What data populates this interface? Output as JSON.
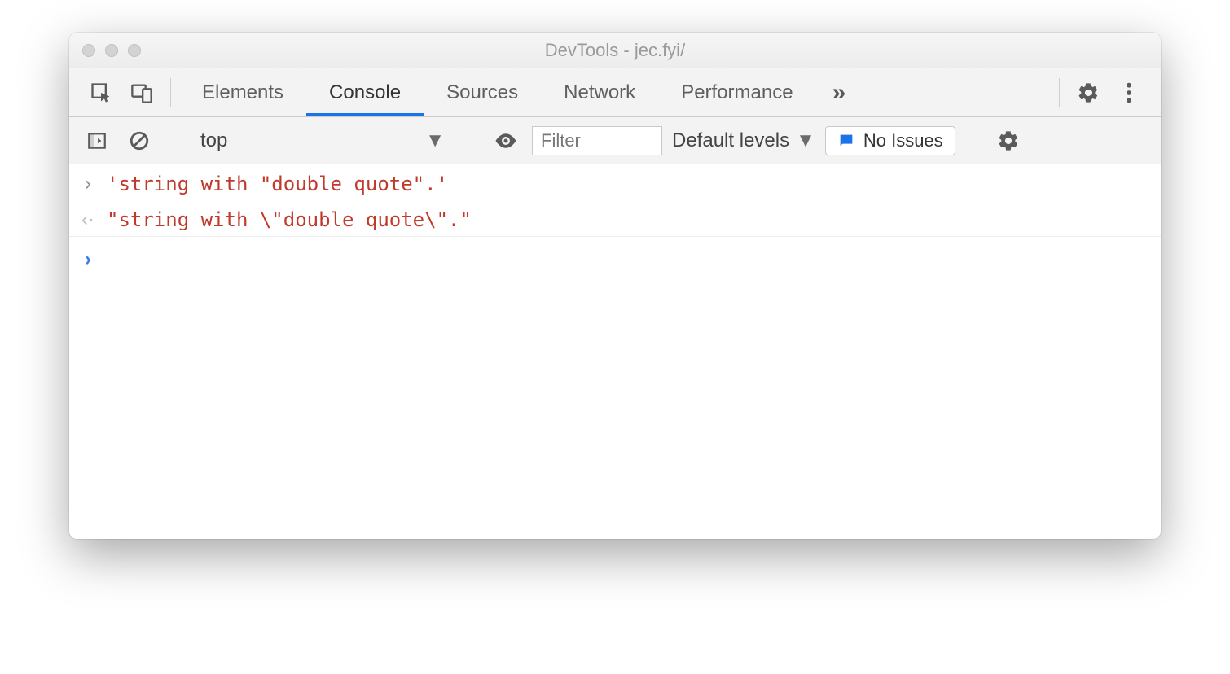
{
  "titlebar": {
    "title": "DevTools - jec.fyi/"
  },
  "tabs": {
    "elements": "Elements",
    "console": "Console",
    "sources": "Sources",
    "network": "Network",
    "performance": "Performance"
  },
  "toolbar": {
    "context": "top",
    "filter_placeholder": "Filter",
    "levels_label": "Default levels",
    "issues_label": "No Issues"
  },
  "console": {
    "input_line": "'string with \"double quote\".'",
    "output_line": "\"string with \\\"double quote\\\".\""
  }
}
